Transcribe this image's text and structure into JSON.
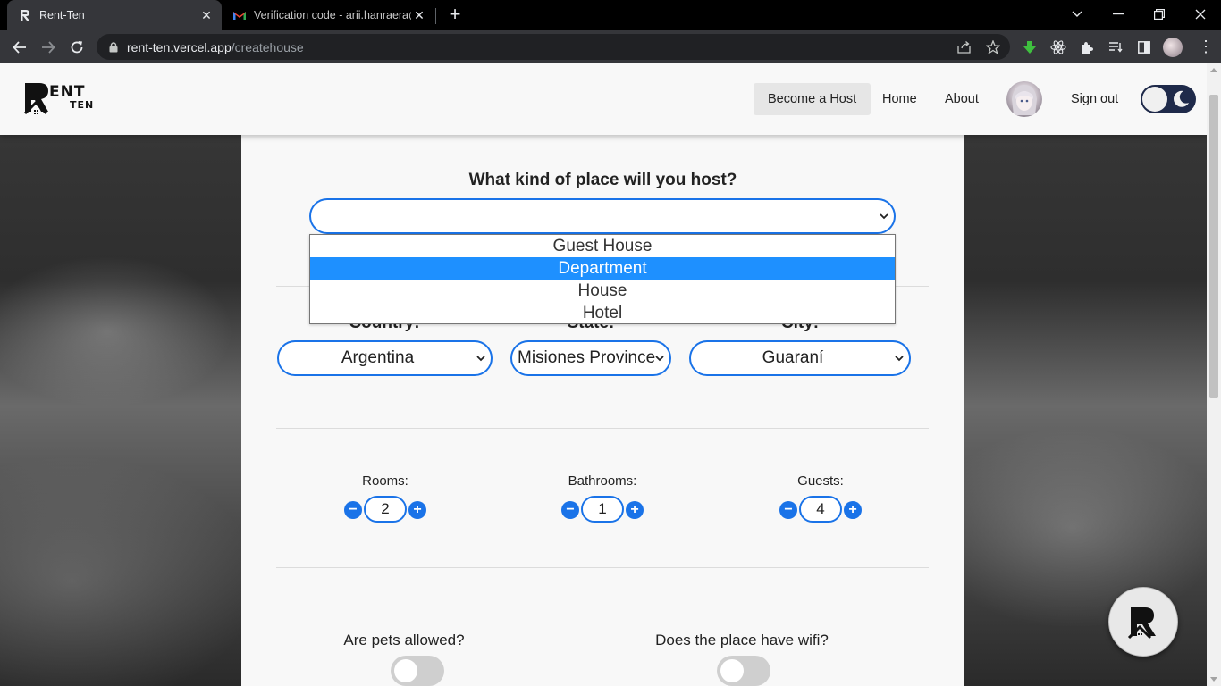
{
  "browser": {
    "tabs": [
      {
        "title": "Rent-Ten",
        "active": true
      },
      {
        "title": "Verification code - arii.hanraera@",
        "active": false
      }
    ],
    "url_host": "rent-ten.vercel.app",
    "url_path": "/createhouse"
  },
  "header": {
    "logo_text_top": "ENT",
    "logo_text_bottom": "TEN",
    "nav": {
      "become_host": "Become a Host",
      "home": "Home",
      "about": "About",
      "sign_out": "Sign out"
    }
  },
  "form": {
    "place_type": {
      "question": "What kind of place will you host?",
      "selected_value": "",
      "options": [
        "Guest House",
        "Department",
        "House",
        "Hotel"
      ],
      "highlighted_option": "Department"
    },
    "location": {
      "country_label": "Country:",
      "state_label": "State:",
      "city_label": "City:",
      "country": "Argentina",
      "state": "Misiones Province",
      "city": "Guaraní"
    },
    "counters": {
      "rooms_label": "Rooms:",
      "rooms": "2",
      "bathrooms_label": "Bathrooms:",
      "bathrooms": "1",
      "guests_label": "Guests:",
      "guests": "4"
    },
    "pets_question": "Are pets allowed?",
    "pets_allowed": false,
    "wifi_question": "Does the place have wifi?",
    "wifi_available": false
  },
  "colors": {
    "accent": "#1a73e8",
    "dropdown_highlight": "#1e90ff",
    "toggle_dark": "#1f2a4a"
  }
}
